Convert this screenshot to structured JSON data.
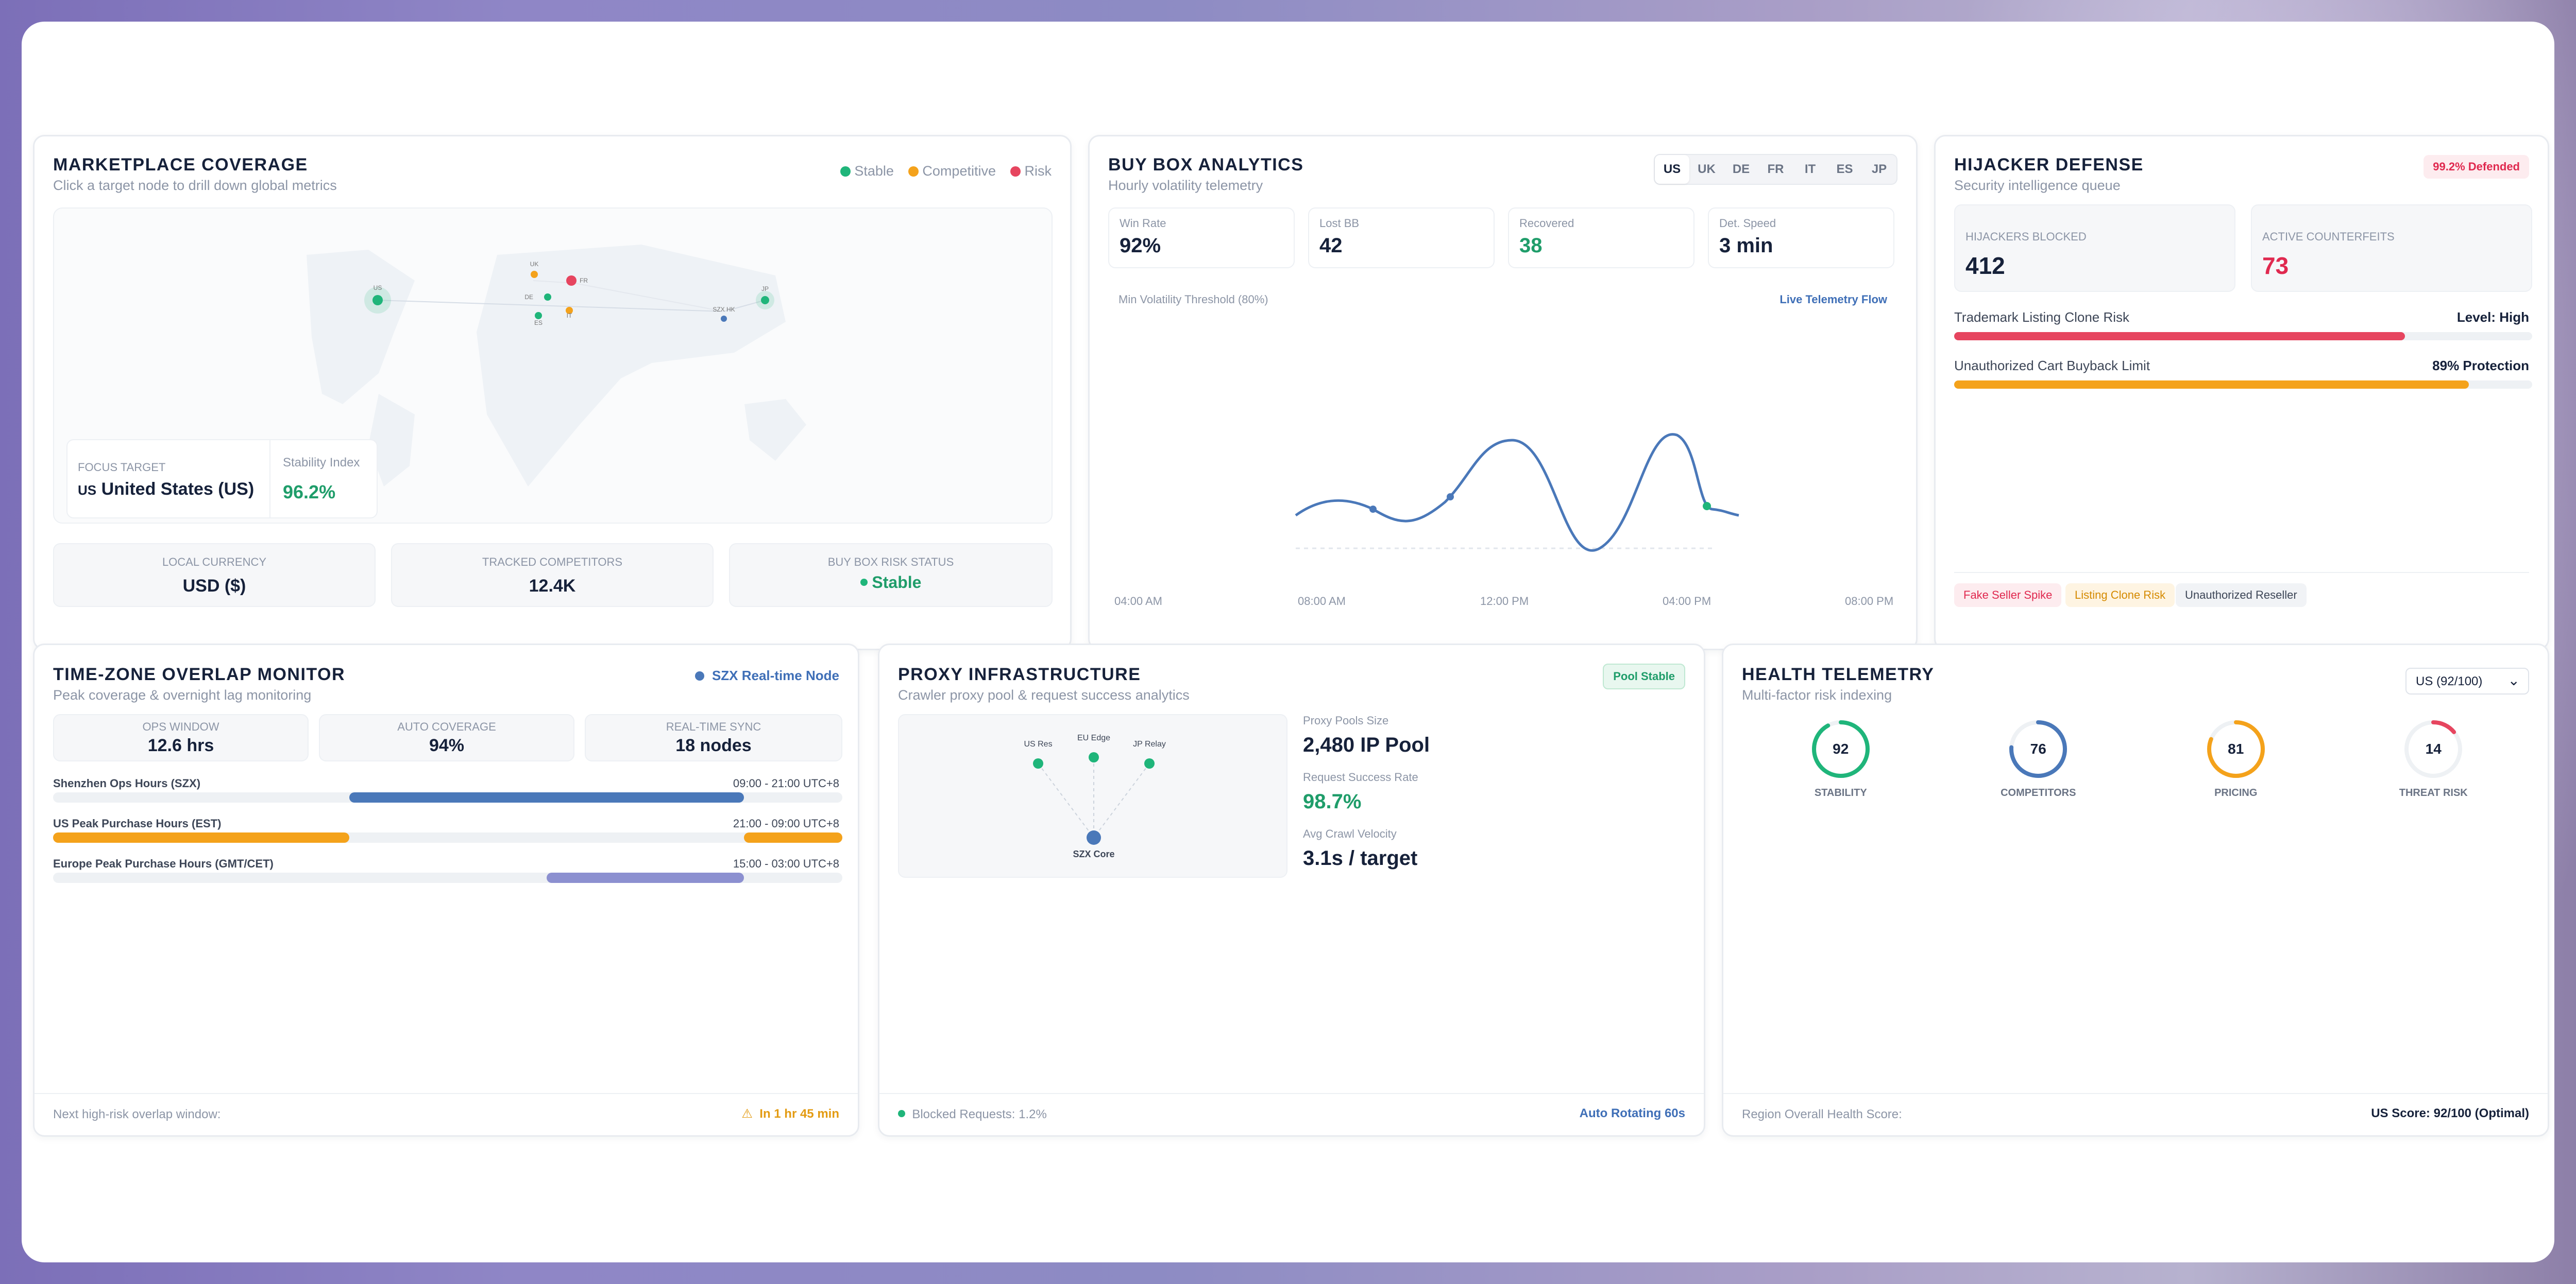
{
  "marketplace": {
    "title": "MARKETPLACE COVERAGE",
    "subtitle": "Click a target node to drill down global metrics",
    "legend": [
      {
        "label": "Stable",
        "color": "#1fb57a"
      },
      {
        "label": "Competitive",
        "color": "#f4a21b"
      },
      {
        "label": "Risk",
        "color": "#e6455f"
      }
    ],
    "nodes": [
      "US",
      "UK",
      "DE",
      "FR",
      "IT",
      "ES",
      "SZX HK",
      "JP"
    ],
    "focus_label": "FOCUS TARGET",
    "focus_code": "US",
    "focus_value": "United States (US)",
    "stability_label": "Stability Index",
    "stability_value": "96.2%",
    "stats": [
      {
        "label": "LOCAL CURRENCY",
        "value": "USD ($)"
      },
      {
        "label": "TRACKED COMPETITORS",
        "value": "12.4K"
      },
      {
        "label": "BUY BOX RISK STATUS",
        "value": "Stable"
      }
    ]
  },
  "buybox": {
    "title": "BUY BOX ANALYTICS",
    "subtitle": "Hourly volatility telemetry",
    "tabs": [
      "US",
      "UK",
      "DE",
      "FR",
      "IT",
      "ES",
      "JP"
    ],
    "active_tab": "US",
    "metrics": [
      {
        "label": "Win Rate",
        "value": "92%"
      },
      {
        "label": "Lost BB",
        "value": "42"
      },
      {
        "label": "Recovered",
        "value": "38"
      },
      {
        "label": "Det. Speed",
        "value": "3 min"
      }
    ],
    "threshold_label": "Min Volatility Threshold (80%)",
    "flow_label": "Live Telemetry Flow",
    "x_ticks": [
      "04:00 AM",
      "08:00 AM",
      "12:00 PM",
      "04:00 PM",
      "08:00 PM"
    ]
  },
  "hijacker": {
    "title": "HIJACKER DEFENSE",
    "subtitle": "Security intelligence queue",
    "badge": "99.2% Defended",
    "stats": [
      {
        "label": "HIJACKERS BLOCKED",
        "value": "412"
      },
      {
        "label": "ACTIVE COUNTERFEITS",
        "value": "73"
      }
    ],
    "bars": [
      {
        "label": "Trademark Listing Clone Risk",
        "right": "Level: High",
        "pct": 0.78,
        "color": "#e6455f"
      },
      {
        "label": "Unauthorized Cart Buyback Limit",
        "right": "89% Protection",
        "pct": 0.89,
        "color": "#f4a21b"
      }
    ],
    "tags": [
      "Fake Seller Spike",
      "Listing Clone Risk",
      "Unauthorized Reseller"
    ]
  },
  "timezone": {
    "title": "TIME-ZONE OVERLAP MONITOR",
    "subtitle": "Peak coverage & overnight lag monitoring",
    "live_label": "SZX Real-time Node",
    "stats": [
      {
        "label": "OPS WINDOW",
        "value": "12.6 hrs"
      },
      {
        "label": "AUTO COVERAGE",
        "value": "94%"
      },
      {
        "label": "REAL-TIME SYNC",
        "value": "18 nodes"
      }
    ],
    "rows": [
      {
        "label": "Shenzhen Ops Hours (SZX)",
        "range": "09:00 - 21:00 UTC+8"
      },
      {
        "label": "US Peak Purchase Hours (EST)",
        "range": "21:00 - 09:00 UTC+8"
      },
      {
        "label": "Europe Peak Purchase Hours (GMT/CET)",
        "range": "15:00 - 03:00 UTC+8"
      }
    ],
    "footer_label": "Next high-risk overlap window:",
    "footer_value": "In 1 hr 45 min"
  },
  "proxy": {
    "title": "PROXY INFRASTRUCTURE",
    "subtitle": "Crawler proxy pool & request success analytics",
    "badge": "Pool Stable",
    "nodes": [
      "US Res",
      "EU Edge",
      "JP Relay",
      "SZX Core"
    ],
    "metrics": [
      {
        "label": "Proxy Pools Size",
        "value": "2,480 IP Pool"
      },
      {
        "label": "Request Success Rate",
        "value": "98.7%"
      },
      {
        "label": "Avg Crawl Velocity",
        "value": "3.1s / target"
      }
    ],
    "footer_label": "Blocked Requests: 1.2%",
    "footer_value": "Auto Rotating 60s"
  },
  "health": {
    "title": "HEALTH TELEMETRY",
    "subtitle": "Multi-factor risk indexing",
    "select_value": "US (92/100)",
    "gauges": [
      {
        "label": "STABILITY",
        "value": "92",
        "pct": 0.92,
        "color": "#1fb57a"
      },
      {
        "label": "COMPETITORS",
        "value": "76",
        "pct": 0.76,
        "color": "#4a78b9"
      },
      {
        "label": "PRICING",
        "value": "81",
        "pct": 0.81,
        "color": "#f4a21b"
      },
      {
        "label": "THREAT RISK",
        "value": "14",
        "pct": 0.14,
        "color": "#e6455f"
      }
    ],
    "footer_label": "Region Overall Health Score:",
    "footer_value": "US Score: 92/100 (Optimal)"
  }
}
